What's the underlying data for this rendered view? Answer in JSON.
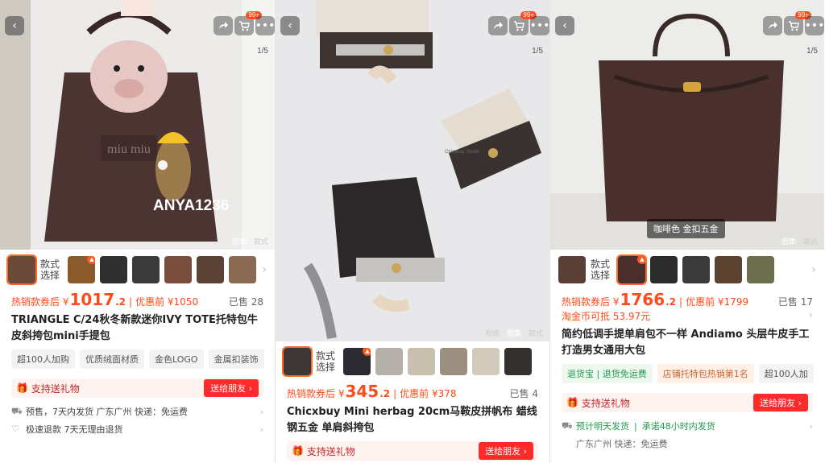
{
  "panels": [
    {
      "image": {
        "counter": "1/5",
        "caption": "ANYA1236",
        "tabs": [
          "图集",
          "款式"
        ],
        "cart_badge": "99+"
      },
      "style_label": "款式选择",
      "price": {
        "prefix": "热销款券后 ¥",
        "int": "1017",
        "dec": ".2",
        "before_label": "优惠前 ¥",
        "before": "1050",
        "sold": "已售 28"
      },
      "title": "TRIANGLE C/24秋冬新款迷你IVY TOTE托特包牛皮斜挎包mini手提包",
      "tags": [
        "超100人加购",
        "优质绒面材质",
        "金色LOGO",
        "金属扣装饰"
      ],
      "gift": {
        "label": "支持送礼物",
        "button": "送给朋友"
      },
      "rows": [
        {
          "icon": "truck-icon",
          "text": "预售，7天内发货  广东广州  快递：免运费"
        },
        {
          "icon": "heart-icon",
          "text": "极速退款    7天无理由退货"
        }
      ]
    },
    {
      "image": {
        "counter": "1/5",
        "watermark": "Chicxbuy Studio",
        "tabs": [
          "视频",
          "图集",
          "款式"
        ],
        "cart_badge": "99+"
      },
      "style_label": "款式选择",
      "price": {
        "prefix": "热销款券后 ¥",
        "int": "345",
        "dec": ".2",
        "before_label": "优惠前 ¥",
        "before": "378",
        "sold": "已售 4"
      },
      "title": "Chicxbuy Mini herbag 20cm马鞍皮拼帆布 蜡线钢五金 单肩斜挎包",
      "gift": {
        "label": "支持送礼物",
        "button": "送给朋友"
      }
    },
    {
      "image": {
        "counter": "1/5",
        "chip": "咖啡色 金扣五金",
        "tabs": [
          "图集",
          "款式"
        ],
        "cart_badge": "99+"
      },
      "style_label": "款式选择",
      "price": {
        "prefix": "热销款券后 ¥",
        "int": "1766",
        "dec": ".2",
        "before_label": "优惠前 ¥",
        "before": "1799",
        "sold": "已售 17"
      },
      "coin": "淘金币可抵 53.97元",
      "title": "简约低调手提单肩包不一样 Andiamo 头层牛皮手工打造男女通用大包",
      "tags": [
        "退货宝 | 退货免运费",
        "店铺托特包热销第1名",
        "超100人加"
      ],
      "gift": {
        "label": "支持送礼物",
        "button": "送给朋友"
      },
      "rows": [
        {
          "icon": "truck-icon",
          "text": "预计明天发货",
          "extra": "承诺48小时内发货"
        },
        {
          "icon": "",
          "text": "广东广州  快递：免运费"
        }
      ]
    }
  ],
  "colors": {
    "accent": "#ff4a1a",
    "gift": "#ff2a2a",
    "green": "#1f9a4c"
  }
}
